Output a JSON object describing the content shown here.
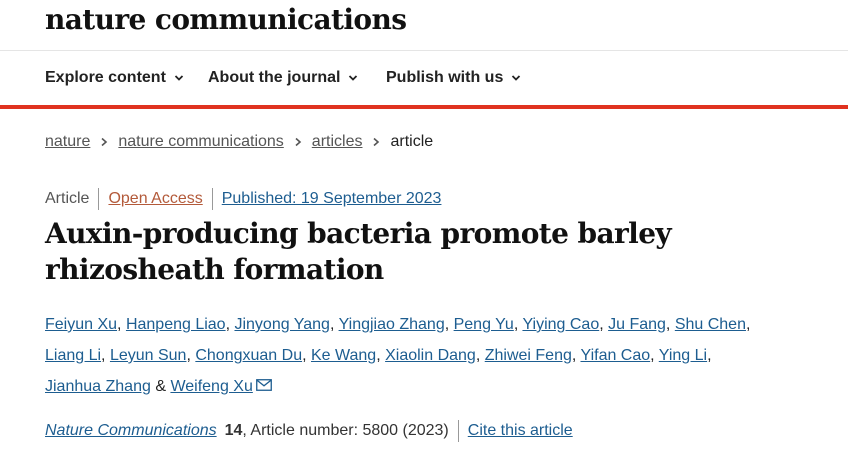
{
  "header": {
    "logo_text": "nature communications"
  },
  "nav": {
    "items": [
      {
        "label": "Explore content",
        "icon": "chevron-down-icon"
      },
      {
        "label": "About the journal",
        "icon": "chevron-down-icon"
      },
      {
        "label": "Publish with us",
        "icon": "chevron-down-icon"
      }
    ]
  },
  "breadcrumb": {
    "items": [
      "nature",
      "nature communications",
      "articles"
    ],
    "current": "article"
  },
  "meta": {
    "type": "Article",
    "open_access": "Open Access",
    "published": "Published: 19 September 2023"
  },
  "article": {
    "title": "Auxin-producing bacteria promote barley rhizosheath formation"
  },
  "authors": {
    "list": [
      "Feiyun Xu",
      "Hanpeng Liao",
      "Jinyong Yang",
      "Yingjiao Zhang",
      "Peng Yu",
      "Yiying Cao",
      "Ju Fang",
      "Shu Chen",
      "Liang Li",
      "Leyun Sun",
      "Chongxuan Du",
      "Ke Wang",
      "Xiaolin Dang",
      "Zhiwei Feng",
      "Yifan Cao",
      "Ying Li",
      "Jianhua Zhang",
      "Weifeng Xu"
    ],
    "conjunction": "&"
  },
  "citation": {
    "journal": "Nature Communications",
    "volume": "14",
    "article_number": ", Article number: 5800 (2023)",
    "cite_label": "Cite this article"
  },
  "colors": {
    "accent_red": "#e0321f",
    "link_blue": "#1d5d90",
    "open_access": "#b35a3a"
  }
}
